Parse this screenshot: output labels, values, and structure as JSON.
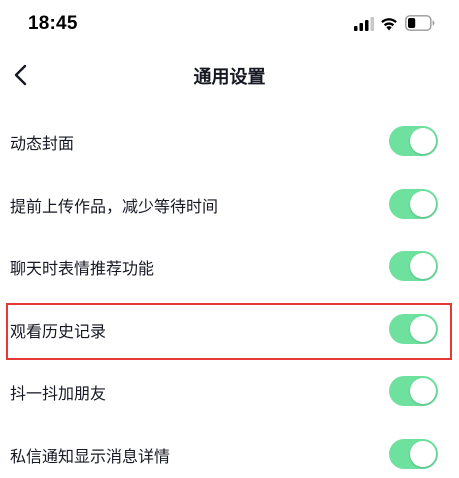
{
  "status_bar": {
    "time": "18:45",
    "icons": [
      "signal-icon",
      "wifi-icon",
      "battery-icon"
    ],
    "battery_level": 0.35
  },
  "nav": {
    "back_icon": "chevron-left-icon",
    "title": "通用设置"
  },
  "settings": [
    {
      "id": "dynamic-cover",
      "label": "动态封面",
      "enabled": true
    },
    {
      "id": "upload-ahead",
      "label": "提前上传作品，减少等待时间",
      "enabled": true
    },
    {
      "id": "chat-emoji-recommend",
      "label": "聊天时表情推荐功能",
      "enabled": true
    },
    {
      "id": "watch-history",
      "label": "观看历史记录",
      "enabled": true,
      "highlighted": true
    },
    {
      "id": "add-friends",
      "label": "抖一抖加朋友",
      "enabled": true
    },
    {
      "id": "dm-preview",
      "label": "私信通知显示消息详情",
      "enabled": true
    }
  ],
  "colors": {
    "toggle_on": "#6ee19f",
    "highlight": "#e53935",
    "text": "#161823"
  }
}
